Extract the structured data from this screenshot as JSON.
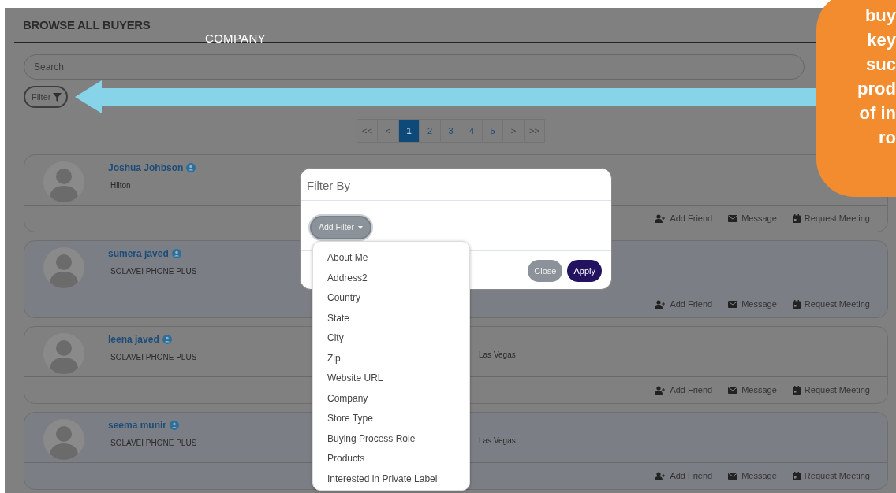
{
  "header": {
    "title": "BROWSE ALL BUYERS"
  },
  "overlay_label": "COMPANY",
  "search": {
    "placeholder": "Search"
  },
  "filter_button": {
    "label": "Filter"
  },
  "pagination": [
    {
      "label": "<<",
      "selected": false
    },
    {
      "label": "<",
      "selected": false
    },
    {
      "label": "1",
      "selected": true
    },
    {
      "label": "2",
      "selected": false
    },
    {
      "label": "3",
      "selected": false
    },
    {
      "label": "4",
      "selected": false
    },
    {
      "label": "5",
      "selected": false
    },
    {
      "label": ">",
      "selected": false
    },
    {
      "label": ">>",
      "selected": false
    }
  ],
  "buyers": [
    {
      "name": "Joshua Johbson",
      "company": "Hilton",
      "actions": [
        {
          "kind": "friend",
          "label": "Add Friend"
        },
        {
          "kind": "message",
          "label": "Message"
        },
        {
          "kind": "meeting",
          "label": "Request Meeting"
        }
      ]
    },
    {
      "name": "sumera javed",
      "company": "SOLAVEI PHONE PLUS",
      "actions": [
        {
          "kind": "friend",
          "label": "Add Friend"
        },
        {
          "kind": "message",
          "label": "Message"
        },
        {
          "kind": "meeting",
          "label": "Request Meeting"
        }
      ]
    },
    {
      "name": "leena javed",
      "company": "SOLAVEI PHONE PLUS",
      "city": "Las Vegas",
      "actions": [
        {
          "kind": "friend",
          "label": "Add Friend"
        },
        {
          "kind": "message",
          "label": "Message"
        },
        {
          "kind": "meeting",
          "label": "Request Meeting"
        }
      ]
    },
    {
      "name": "seema munir",
      "company": "SOLAVEI PHONE PLUS",
      "city": "Las Vegas",
      "actions": [
        {
          "kind": "friend",
          "label": "Add Friend"
        },
        {
          "kind": "message",
          "label": "Message"
        },
        {
          "kind": "meeting",
          "label": "Request Meeting"
        }
      ]
    }
  ],
  "modal": {
    "title": "Filter By",
    "add_filter": "Add Filter",
    "options": [
      "About Me",
      "Address2",
      "Country",
      "State",
      "City",
      "Zip",
      "Website URL",
      "Company",
      "Store Type",
      "Buying Process Role",
      "Products",
      "Interested in Private Label"
    ],
    "buttons": [
      {
        "kind": "close",
        "label": "Close"
      },
      {
        "kind": "apply",
        "label": "Apply"
      }
    ]
  },
  "callout": {
    "lines": [
      "buy",
      "key",
      "suc",
      "prod",
      "of in",
      "ro"
    ]
  }
}
